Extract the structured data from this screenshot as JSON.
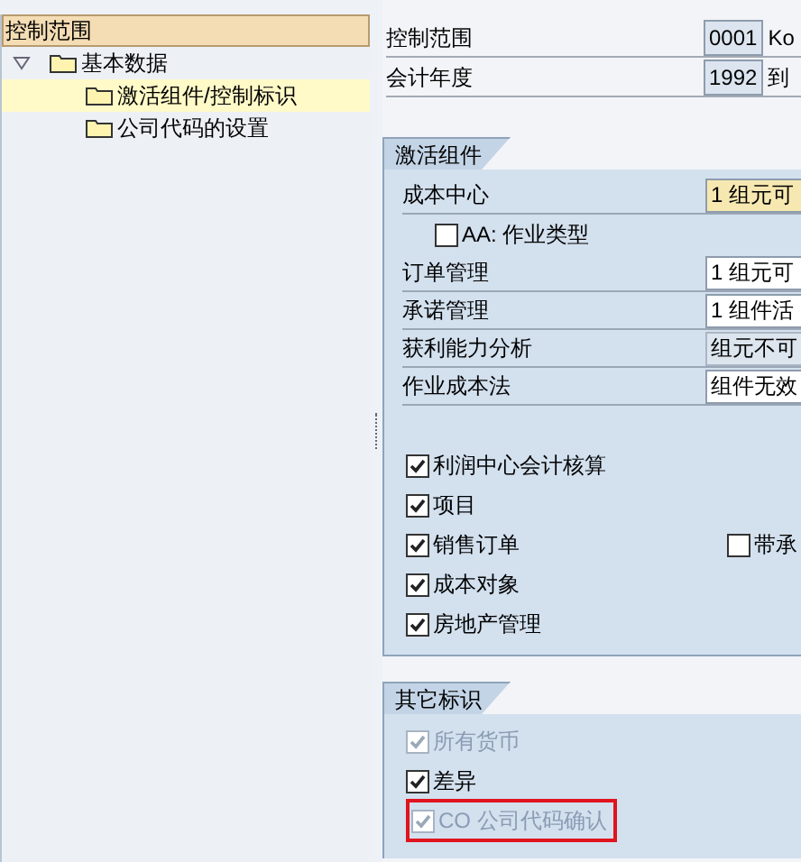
{
  "tree": {
    "header": "控制范围",
    "items": [
      {
        "label": "基本数据",
        "expanded": true,
        "selected": false,
        "children": [
          {
            "label": "激活组件/控制标识",
            "selected": true
          },
          {
            "label": "公司代码的设置",
            "selected": false
          }
        ]
      }
    ]
  },
  "header_fields": [
    {
      "label": "控制范围",
      "value": "0001",
      "suffix": "Ko"
    },
    {
      "label": "会计年度",
      "value": "1992",
      "suffix": "到"
    }
  ],
  "sections": [
    {
      "title": "激活组件",
      "rows": [
        {
          "kind": "field",
          "label": "成本中心",
          "value": "1 组元可",
          "focused": true,
          "disabled": false
        },
        {
          "kind": "checkbox",
          "label": "AA: 作业类型",
          "checked": false,
          "disabled": false,
          "indent": true,
          "highlighted": false
        },
        {
          "kind": "field",
          "label": "订单管理",
          "value": "1 组元可",
          "focused": false,
          "disabled": false
        },
        {
          "kind": "field",
          "label": "承诺管理",
          "value": "1 组件活",
          "focused": false,
          "disabled": false
        },
        {
          "kind": "field",
          "label": "获利能力分析",
          "value": "组元不可",
          "focused": false,
          "disabled": true
        },
        {
          "kind": "field",
          "label": "作业成本法",
          "value": "组件无效",
          "focused": false,
          "disabled": false
        },
        {
          "kind": "gap"
        },
        {
          "kind": "checkbox",
          "label": "利润中心会计核算",
          "checked": true,
          "disabled": false,
          "highlighted": false
        },
        {
          "kind": "checkbox",
          "label": "项目",
          "checked": true,
          "disabled": false,
          "highlighted": false
        },
        {
          "kind": "checkbox",
          "label": "销售订单",
          "checked": true,
          "disabled": false,
          "highlighted": false,
          "extra": {
            "label": "带承",
            "checked": false
          }
        },
        {
          "kind": "checkbox",
          "label": "成本对象",
          "checked": true,
          "disabled": false,
          "highlighted": false
        },
        {
          "kind": "checkbox",
          "label": "房地产管理",
          "checked": true,
          "disabled": false,
          "highlighted": false
        }
      ]
    },
    {
      "title": "其它标识",
      "rows": [
        {
          "kind": "checkbox",
          "label": "所有货币",
          "checked": true,
          "disabled": true,
          "highlighted": false
        },
        {
          "kind": "checkbox",
          "label": "差异",
          "checked": true,
          "disabled": false,
          "highlighted": false
        },
        {
          "kind": "checkbox",
          "label": "CO 公司代码确认",
          "checked": true,
          "disabled": true,
          "highlighted": true
        }
      ]
    }
  ]
}
